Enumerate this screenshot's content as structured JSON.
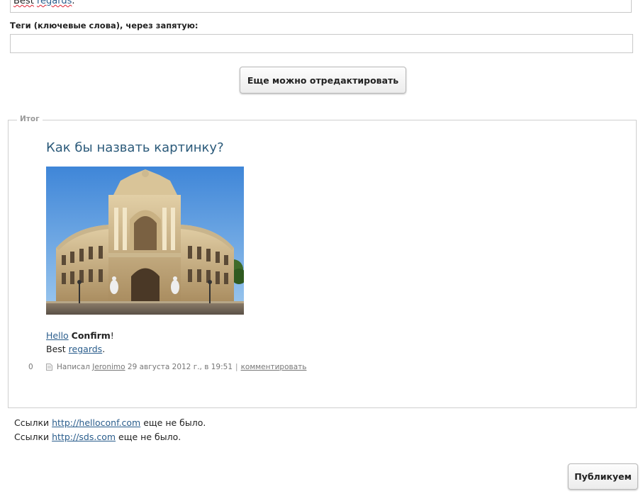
{
  "editor": {
    "preview_word_1": "Best",
    "preview_link": "regards",
    "preview_end": "."
  },
  "tags": {
    "label": "Теги (ключевые слова), через запятую:",
    "value": ""
  },
  "edit_button": "Еще можно отредактировать",
  "result": {
    "legend": "Итог",
    "title": "Как бы назвать картинку?",
    "body": {
      "hello_link": "Hello",
      "bold": "Confirm",
      "exclaim": "!",
      "best": "Best",
      "regards_link": "regards",
      "period": "."
    },
    "meta": {
      "count": "0",
      "written_by": "Написал",
      "author": "Jeronimo",
      "date": "29 августа 2012 г., в 19:51",
      "separator": "|",
      "comment_link": "комментировать"
    }
  },
  "notes": [
    {
      "prefix": "Ссылки",
      "url": "http://helloconf.com",
      "suffix": "еще не было."
    },
    {
      "prefix": "Ссылки",
      "url": "http://sds.com",
      "suffix": "еще не было."
    }
  ],
  "publish_button": "Публикуем"
}
